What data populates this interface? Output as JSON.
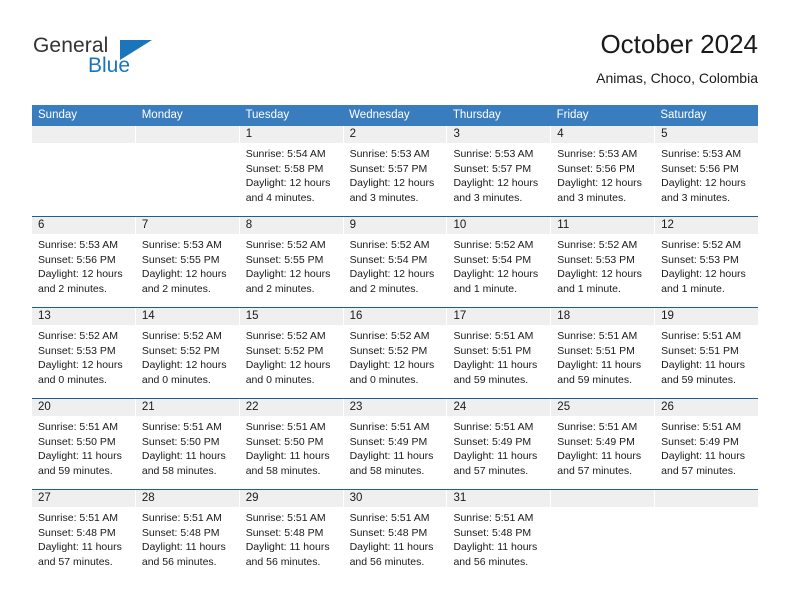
{
  "logo": {
    "primary_text": "General",
    "secondary_text": "Blue",
    "icon": "triangle-icon",
    "primary_color": "#333333",
    "accent_color": "#1b75bb"
  },
  "header": {
    "title": "October 2024",
    "subtitle": "Animas, Choco, Colombia"
  },
  "theme": {
    "header_bar_color": "#3a7dbf",
    "row_divider_color": "#1f5d96",
    "day_band_color": "#efefef"
  },
  "weekdays": [
    "Sunday",
    "Monday",
    "Tuesday",
    "Wednesday",
    "Thursday",
    "Friday",
    "Saturday"
  ],
  "weeks": [
    [
      {
        "day": "",
        "lines": []
      },
      {
        "day": "",
        "lines": []
      },
      {
        "day": "1",
        "lines": [
          "Sunrise: 5:54 AM",
          "Sunset: 5:58 PM",
          "Daylight: 12 hours",
          "and 4 minutes."
        ]
      },
      {
        "day": "2",
        "lines": [
          "Sunrise: 5:53 AM",
          "Sunset: 5:57 PM",
          "Daylight: 12 hours",
          "and 3 minutes."
        ]
      },
      {
        "day": "3",
        "lines": [
          "Sunrise: 5:53 AM",
          "Sunset: 5:57 PM",
          "Daylight: 12 hours",
          "and 3 minutes."
        ]
      },
      {
        "day": "4",
        "lines": [
          "Sunrise: 5:53 AM",
          "Sunset: 5:56 PM",
          "Daylight: 12 hours",
          "and 3 minutes."
        ]
      },
      {
        "day": "5",
        "lines": [
          "Sunrise: 5:53 AM",
          "Sunset: 5:56 PM",
          "Daylight: 12 hours",
          "and 3 minutes."
        ]
      }
    ],
    [
      {
        "day": "6",
        "lines": [
          "Sunrise: 5:53 AM",
          "Sunset: 5:56 PM",
          "Daylight: 12 hours",
          "and 2 minutes."
        ]
      },
      {
        "day": "7",
        "lines": [
          "Sunrise: 5:53 AM",
          "Sunset: 5:55 PM",
          "Daylight: 12 hours",
          "and 2 minutes."
        ]
      },
      {
        "day": "8",
        "lines": [
          "Sunrise: 5:52 AM",
          "Sunset: 5:55 PM",
          "Daylight: 12 hours",
          "and 2 minutes."
        ]
      },
      {
        "day": "9",
        "lines": [
          "Sunrise: 5:52 AM",
          "Sunset: 5:54 PM",
          "Daylight: 12 hours",
          "and 2 minutes."
        ]
      },
      {
        "day": "10",
        "lines": [
          "Sunrise: 5:52 AM",
          "Sunset: 5:54 PM",
          "Daylight: 12 hours",
          "and 1 minute."
        ]
      },
      {
        "day": "11",
        "lines": [
          "Sunrise: 5:52 AM",
          "Sunset: 5:53 PM",
          "Daylight: 12 hours",
          "and 1 minute."
        ]
      },
      {
        "day": "12",
        "lines": [
          "Sunrise: 5:52 AM",
          "Sunset: 5:53 PM",
          "Daylight: 12 hours",
          "and 1 minute."
        ]
      }
    ],
    [
      {
        "day": "13",
        "lines": [
          "Sunrise: 5:52 AM",
          "Sunset: 5:53 PM",
          "Daylight: 12 hours",
          "and 0 minutes."
        ]
      },
      {
        "day": "14",
        "lines": [
          "Sunrise: 5:52 AM",
          "Sunset: 5:52 PM",
          "Daylight: 12 hours",
          "and 0 minutes."
        ]
      },
      {
        "day": "15",
        "lines": [
          "Sunrise: 5:52 AM",
          "Sunset: 5:52 PM",
          "Daylight: 12 hours",
          "and 0 minutes."
        ]
      },
      {
        "day": "16",
        "lines": [
          "Sunrise: 5:52 AM",
          "Sunset: 5:52 PM",
          "Daylight: 12 hours",
          "and 0 minutes."
        ]
      },
      {
        "day": "17",
        "lines": [
          "Sunrise: 5:51 AM",
          "Sunset: 5:51 PM",
          "Daylight: 11 hours",
          "and 59 minutes."
        ]
      },
      {
        "day": "18",
        "lines": [
          "Sunrise: 5:51 AM",
          "Sunset: 5:51 PM",
          "Daylight: 11 hours",
          "and 59 minutes."
        ]
      },
      {
        "day": "19",
        "lines": [
          "Sunrise: 5:51 AM",
          "Sunset: 5:51 PM",
          "Daylight: 11 hours",
          "and 59 minutes."
        ]
      }
    ],
    [
      {
        "day": "20",
        "lines": [
          "Sunrise: 5:51 AM",
          "Sunset: 5:50 PM",
          "Daylight: 11 hours",
          "and 59 minutes."
        ]
      },
      {
        "day": "21",
        "lines": [
          "Sunrise: 5:51 AM",
          "Sunset: 5:50 PM",
          "Daylight: 11 hours",
          "and 58 minutes."
        ]
      },
      {
        "day": "22",
        "lines": [
          "Sunrise: 5:51 AM",
          "Sunset: 5:50 PM",
          "Daylight: 11 hours",
          "and 58 minutes."
        ]
      },
      {
        "day": "23",
        "lines": [
          "Sunrise: 5:51 AM",
          "Sunset: 5:49 PM",
          "Daylight: 11 hours",
          "and 58 minutes."
        ]
      },
      {
        "day": "24",
        "lines": [
          "Sunrise: 5:51 AM",
          "Sunset: 5:49 PM",
          "Daylight: 11 hours",
          "and 57 minutes."
        ]
      },
      {
        "day": "25",
        "lines": [
          "Sunrise: 5:51 AM",
          "Sunset: 5:49 PM",
          "Daylight: 11 hours",
          "and 57 minutes."
        ]
      },
      {
        "day": "26",
        "lines": [
          "Sunrise: 5:51 AM",
          "Sunset: 5:49 PM",
          "Daylight: 11 hours",
          "and 57 minutes."
        ]
      }
    ],
    [
      {
        "day": "27",
        "lines": [
          "Sunrise: 5:51 AM",
          "Sunset: 5:48 PM",
          "Daylight: 11 hours",
          "and 57 minutes."
        ]
      },
      {
        "day": "28",
        "lines": [
          "Sunrise: 5:51 AM",
          "Sunset: 5:48 PM",
          "Daylight: 11 hours",
          "and 56 minutes."
        ]
      },
      {
        "day": "29",
        "lines": [
          "Sunrise: 5:51 AM",
          "Sunset: 5:48 PM",
          "Daylight: 11 hours",
          "and 56 minutes."
        ]
      },
      {
        "day": "30",
        "lines": [
          "Sunrise: 5:51 AM",
          "Sunset: 5:48 PM",
          "Daylight: 11 hours",
          "and 56 minutes."
        ]
      },
      {
        "day": "31",
        "lines": [
          "Sunrise: 5:51 AM",
          "Sunset: 5:48 PM",
          "Daylight: 11 hours",
          "and 56 minutes."
        ]
      },
      {
        "day": "",
        "lines": []
      },
      {
        "day": "",
        "lines": []
      }
    ]
  ]
}
